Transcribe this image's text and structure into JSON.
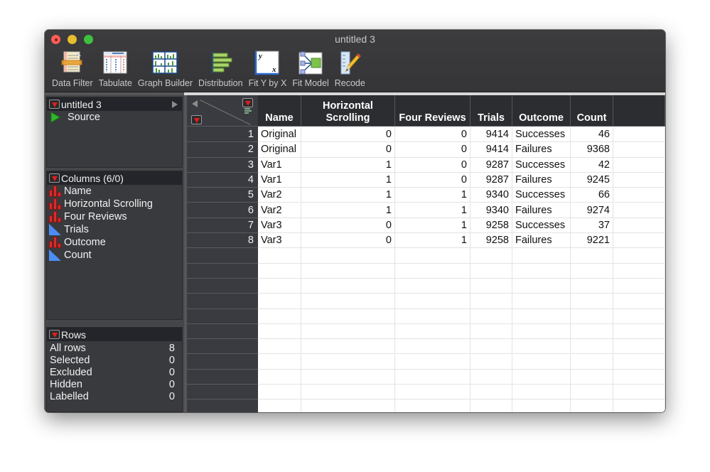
{
  "window": {
    "title": "untitled 3"
  },
  "toolbar": {
    "items": [
      {
        "label": "Data Filter",
        "icon": "data-filter-icon"
      },
      {
        "label": "Tabulate",
        "icon": "tabulate-icon"
      },
      {
        "label": "Graph Builder",
        "icon": "graph-builder-icon"
      },
      {
        "label": "Distribution",
        "icon": "distribution-icon"
      },
      {
        "label": "Fit Y by X",
        "icon": "fit-y-by-x-icon"
      },
      {
        "label": "Fit Model",
        "icon": "fit-model-icon"
      },
      {
        "label": "Recode",
        "icon": "recode-icon"
      }
    ]
  },
  "table_panel": {
    "title": "untitled 3",
    "scripts": [
      {
        "label": "Source"
      }
    ]
  },
  "columns_panel": {
    "title": "Columns (6/0)",
    "columns": [
      {
        "name": "Name",
        "type": "nominal"
      },
      {
        "name": "Horizontal Scrolling",
        "type": "nominal"
      },
      {
        "name": "Four Reviews",
        "type": "nominal"
      },
      {
        "name": "Trials",
        "type": "continuous"
      },
      {
        "name": "Outcome",
        "type": "nominal"
      },
      {
        "name": "Count",
        "type": "continuous"
      }
    ]
  },
  "rows_panel": {
    "title": "Rows",
    "stats": [
      {
        "label": "All rows",
        "value": "8"
      },
      {
        "label": "Selected",
        "value": "0"
      },
      {
        "label": "Excluded",
        "value": "0"
      },
      {
        "label": "Hidden",
        "value": "0"
      },
      {
        "label": "Labelled",
        "value": "0"
      }
    ]
  },
  "grid": {
    "headers": [
      "Name",
      "Horizontal\nScrolling",
      "Four Reviews",
      "Trials",
      "Outcome",
      "Count"
    ],
    "header_lines": [
      [
        "",
        "Name"
      ],
      [
        "Horizontal",
        "Scrolling"
      ],
      [
        "",
        "Four Reviews"
      ],
      [
        "",
        "Trials"
      ],
      [
        "",
        "Outcome"
      ],
      [
        "",
        "Count"
      ]
    ],
    "rows": [
      [
        "Original",
        "0",
        "0",
        "9414",
        "Successes",
        "46"
      ],
      [
        "Original",
        "0",
        "0",
        "9414",
        "Failures",
        "9368"
      ],
      [
        "Var1",
        "1",
        "0",
        "9287",
        "Successes",
        "42"
      ],
      [
        "Var1",
        "1",
        "0",
        "9287",
        "Failures",
        "9245"
      ],
      [
        "Var2",
        "1",
        "1",
        "9340",
        "Successes",
        "66"
      ],
      [
        "Var2",
        "1",
        "1",
        "9340",
        "Failures",
        "9274"
      ],
      [
        "Var3",
        "0",
        "1",
        "9258",
        "Successes",
        "37"
      ],
      [
        "Var3",
        "0",
        "1",
        "9258",
        "Failures",
        "9221"
      ]
    ],
    "row_numbers": [
      "1",
      "2",
      "3",
      "4",
      "5",
      "6",
      "7",
      "8"
    ]
  }
}
